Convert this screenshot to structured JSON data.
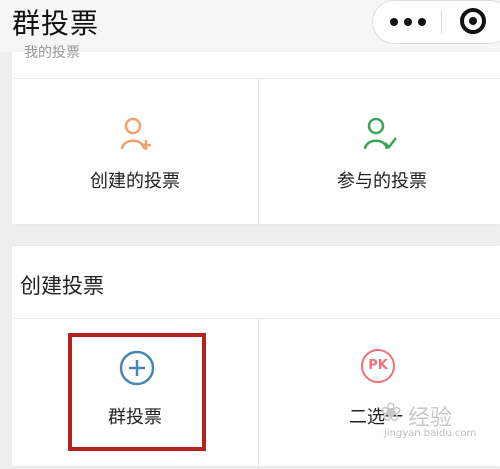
{
  "header": {
    "title": "群投票",
    "more_icon": "more-dots-icon",
    "close_icon": "target-close-icon"
  },
  "top_section": {
    "partial_title": "我的投票",
    "tiles": [
      {
        "label": "创建的投票",
        "icon": "user-add-icon",
        "color": "#f0a26b"
      },
      {
        "label": "参与的投票",
        "icon": "user-check-icon",
        "color": "#3aa655"
      }
    ]
  },
  "create_section": {
    "title": "创建投票",
    "tiles": [
      {
        "label": "群投票",
        "icon": "plus-circle-icon",
        "color": "#4a86b5"
      },
      {
        "label": "二选一",
        "icon": "pk-icon",
        "icon_text": "PK",
        "color": "#e8737a"
      }
    ]
  },
  "colors": {
    "highlight": "#b3221b",
    "background": "#eeeeee"
  },
  "watermark": {
    "text": "经验",
    "url": "jingyan.baidu.com"
  }
}
